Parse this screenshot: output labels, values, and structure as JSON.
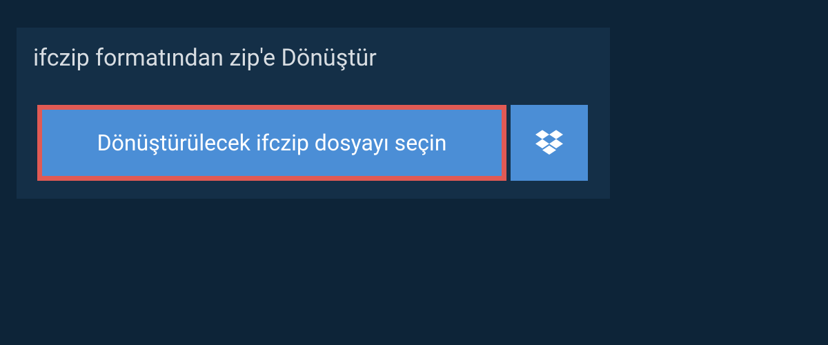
{
  "card": {
    "title": "ifczip formatından zip'e Dönüştür",
    "select_button_label": "Dönüştürülecek ifczip dosyayı seçin"
  }
}
